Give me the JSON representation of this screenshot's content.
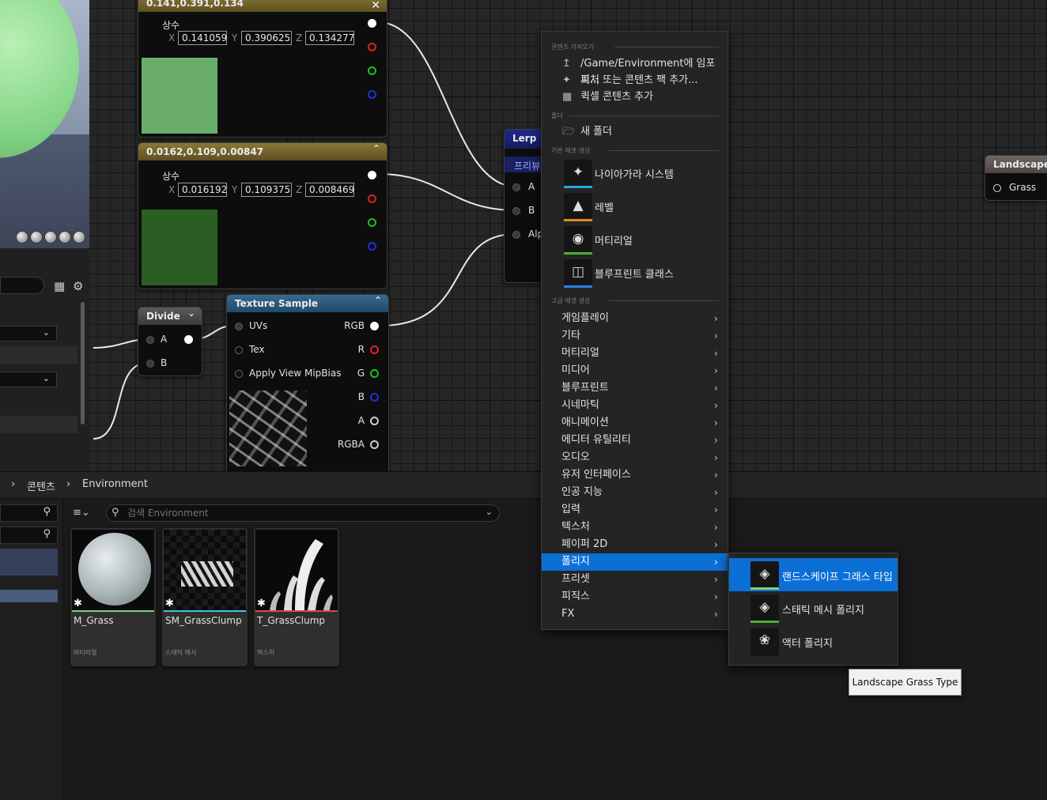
{
  "graph": {
    "const1": {
      "title": "0.141,0.391,0.134",
      "label": "상수",
      "x": "0.141059",
      "y": "0.390625",
      "z": "0.134277",
      "axis_x": "X",
      "axis_y": "Y",
      "axis_z": "Z",
      "color": "#6aad6a"
    },
    "const2": {
      "title": "0.0162,0.109,0.00847",
      "label": "상수",
      "x": "0.016192",
      "y": "0.109375",
      "z": "0.008469",
      "axis_x": "X",
      "axis_y": "Y",
      "axis_z": "Z",
      "color": "#2a5e22"
    },
    "divide": {
      "title": "Divide",
      "pin_a": "A",
      "pin_b": "B"
    },
    "texture_sample": {
      "title": "Texture Sample",
      "inputs": [
        "UVs",
        "Tex",
        "Apply View MipBias"
      ],
      "outputs": [
        "RGB",
        "R",
        "G",
        "B",
        "A",
        "RGBA"
      ]
    },
    "lerp": {
      "title": "Lerp",
      "subtitle": "프리뷰",
      "pins": [
        "A",
        "B",
        "Alp"
      ]
    },
    "landscape": {
      "title": "Landscape",
      "pin": "Grass"
    }
  },
  "content_browser": {
    "breadcrumb": [
      "콘텐츠",
      "Environment"
    ],
    "search_placeholder": "검색 Environment",
    "assets": [
      {
        "name": "M_Grass",
        "type": "머티리얼",
        "accent": "#7ed17e"
      },
      {
        "name": "SM_GrassClump",
        "type": "스태틱 메시",
        "accent": "#3ec6e0"
      },
      {
        "name": "T_GrassClump",
        "type": "텍스처",
        "accent": "#d9464a"
      }
    ]
  },
  "context_menu": {
    "sections": {
      "import": "콘텐츠 가져오기",
      "folder": "폴더",
      "basic": "기본 에셋 생성",
      "advanced": "고급 에셋 생성"
    },
    "import_items": [
      {
        "label": "/Game/Environment에 임포트...",
        "icon": "import-icon"
      },
      {
        "label": "피처 또는 콘텐츠 팩 추가...",
        "icon": "feature-pack-icon"
      },
      {
        "label": "퀵셀 콘텐츠 추가",
        "icon": "quixel-icon"
      }
    ],
    "folder_items": [
      {
        "label": "새 폴더",
        "icon": "new-folder-icon"
      }
    ],
    "basic_items": [
      {
        "label": "나이아가라 시스템",
        "icon": "niagara-icon",
        "accent": "#22a8e0"
      },
      {
        "label": "레벨",
        "icon": "level-icon",
        "accent": "#e08a1e"
      },
      {
        "label": "머티리얼",
        "icon": "material-icon",
        "accent": "#4caf2e"
      },
      {
        "label": "블루프린트 클래스",
        "icon": "blueprint-icon",
        "accent": "#2e7fe0"
      }
    ],
    "advanced_items": [
      "게임플레이",
      "기타",
      "머티리얼",
      "미디어",
      "블루프린트",
      "시네마틱",
      "애니메이션",
      "에디터 유틸리티",
      "오디오",
      "유저 인터페이스",
      "인공 지능",
      "입력",
      "텍스처",
      "페이퍼 2D",
      "폴리지",
      "프리셋",
      "피직스",
      "FX"
    ],
    "active_item": "폴리지"
  },
  "submenu": {
    "items": [
      {
        "label": "랜드스케이프 그래스 타입",
        "icon": "landscape-grass-type-icon",
        "accent": "#7ed17e"
      },
      {
        "label": "스태틱 메시 폴리지",
        "icon": "static-mesh-foliage-icon",
        "accent": "#4caf2e"
      },
      {
        "label": "액터 폴리지",
        "icon": "actor-foliage-icon",
        "accent": "#4caf2e"
      }
    ]
  },
  "tooltip": "Landscape Grass Type"
}
